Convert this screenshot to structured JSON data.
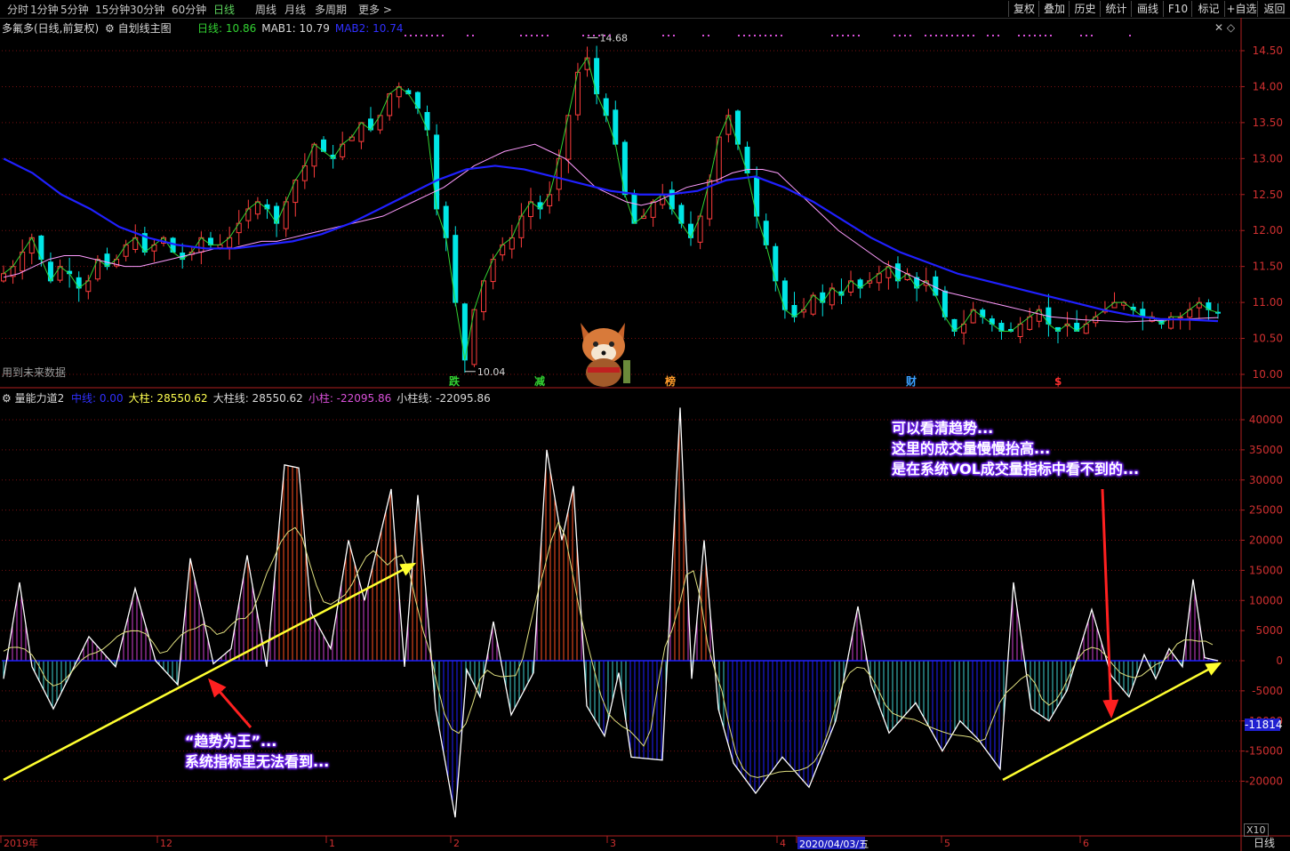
{
  "toolbar": {
    "timeframes": [
      "分时",
      "1分钟",
      "5分钟",
      "15分钟",
      "30分钟",
      "60分钟",
      "日线",
      "周线",
      "月线",
      "多周期",
      "更多 >"
    ],
    "active_index": 6,
    "right_buttons": [
      "复权",
      "叠加",
      "历史",
      "统计",
      "画线",
      "F10",
      "标记",
      "+自选",
      "返回"
    ]
  },
  "main_panel": {
    "title": "多氟多(日线,前复权)",
    "subtitle": "自划线主图",
    "indicators": [
      {
        "label": "日线: 10.86",
        "color": "#32d232"
      },
      {
        "label": "MAB1: 10.79",
        "color": "#d8d8d8"
      },
      {
        "label": "MAB2: 10.74",
        "color": "#3030ff"
      }
    ],
    "note": "用到未来数据",
    "high_label": "14.68",
    "low_label": "10.04",
    "markers": [
      {
        "text": "跌",
        "color": "#32d232"
      },
      {
        "text": "减",
        "color": "#32d232"
      },
      {
        "text": "榜",
        "color": "#ff9c2a"
      },
      {
        "text": "财",
        "color": "#3aa0ff"
      },
      {
        "text": "$",
        "color": "#ff3030"
      }
    ]
  },
  "sub_panel": {
    "title": "量能力道2",
    "indicators": [
      {
        "label": "中线: 0.00",
        "color": "#3030ff"
      },
      {
        "label": "大柱: 28550.62",
        "color": "#ffff50"
      },
      {
        "label": "大柱线: 28550.62",
        "color": "#d8d8d8"
      },
      {
        "label": "小柱: -22095.86",
        "color": "#d850d8"
      },
      {
        "label": "小柱线: -22095.86",
        "color": "#d8d8d8"
      }
    ],
    "current_value": "-11814",
    "scale_note": "X10"
  },
  "annotations": {
    "left": [
      "“趋势为王”...",
      "系统指标里无法看到..."
    ],
    "right": [
      "可以看清趋势...",
      "这里的成交量慢慢抬高...",
      "是在系统VOL成交量指标中看不到的..."
    ]
  },
  "x_axis": {
    "labels": [
      "2019年",
      "12",
      "1",
      "2",
      "3",
      "4",
      "2020/04/03/五",
      "5",
      "6"
    ],
    "period_label": "日线"
  },
  "colors": {
    "up": "#ff3c3c",
    "down": "#00e6e6",
    "ma_long": "#2020ff",
    "ma_mid": "#ff9cff",
    "ma_short": "#32d232"
  },
  "chart_data": [
    {
      "type": "candlestick",
      "title": "多氟多(日线,前复权)",
      "yaxis_ticks": [
        14.5,
        14.0,
        13.5,
        13.0,
        12.5,
        12.0,
        11.5,
        11.0,
        10.5,
        10.0
      ],
      "ylim": [
        9.9,
        14.85
      ],
      "annotated_high": 14.68,
      "annotated_low": 10.04,
      "close_series": [
        11.4,
        11.5,
        11.7,
        11.9,
        11.6,
        11.3,
        11.5,
        11.4,
        11.2,
        11.3,
        11.6,
        11.5,
        11.6,
        11.8,
        11.9,
        11.7,
        11.8,
        11.9,
        11.7,
        11.6,
        11.7,
        11.9,
        11.8,
        11.8,
        11.9,
        12.1,
        12.3,
        12.4,
        12.3,
        12.1,
        12.4,
        12.7,
        12.9,
        13.2,
        13.1,
        13.0,
        13.2,
        13.3,
        13.5,
        13.4,
        13.6,
        13.9,
        14.0,
        13.9,
        13.7,
        13.4,
        12.3,
        11.9,
        11.0,
        10.2,
        10.9,
        11.3,
        11.6,
        11.8,
        11.9,
        12.2,
        12.4,
        12.3,
        12.5,
        13.0,
        13.6,
        14.2,
        14.4,
        13.9,
        13.6,
        13.2,
        12.5,
        12.1,
        12.2,
        12.4,
        12.5,
        12.3,
        12.1,
        11.9,
        12.2,
        12.7,
        13.3,
        13.6,
        13.2,
        12.8,
        12.2,
        11.8,
        11.3,
        10.9,
        10.8,
        10.9,
        11.1,
        11.0,
        11.2,
        11.1,
        11.3,
        11.2,
        11.3,
        11.4,
        11.5,
        11.3,
        11.4,
        11.2,
        11.3,
        11.1,
        10.8,
        10.6,
        10.7,
        10.9,
        10.8,
        10.7,
        10.6,
        10.6,
        10.7,
        10.8,
        10.9,
        10.7,
        10.6,
        10.7,
        10.6,
        10.7,
        10.8,
        10.9,
        11.0,
        11.0,
        10.9,
        10.8,
        10.8,
        10.7,
        10.8,
        10.8,
        10.9,
        11.0,
        10.9,
        10.86
      ],
      "ma_mid": [
        11.35,
        11.4,
        11.5,
        11.6,
        11.65,
        11.65,
        11.6,
        11.55,
        11.5,
        11.5,
        11.55,
        11.6,
        11.65,
        11.7,
        11.75,
        11.75,
        11.8,
        11.85,
        11.85,
        11.9,
        11.95,
        12.0,
        12.05,
        12.1,
        12.15,
        12.2,
        12.3,
        12.4,
        12.5,
        12.6,
        12.75,
        12.9,
        13.0,
        13.1,
        13.15,
        13.2,
        13.1,
        13.0,
        12.8,
        12.6,
        12.5,
        12.4,
        12.35,
        12.4,
        12.5,
        12.6,
        12.65,
        12.7,
        12.8,
        12.85,
        12.85,
        12.8,
        12.6,
        12.4,
        12.2,
        12.0,
        11.85,
        11.7,
        11.55,
        11.45,
        11.35,
        11.25,
        11.15,
        11.1,
        11.05,
        11.0,
        10.95,
        10.9,
        10.85,
        10.8,
        10.78,
        10.76,
        10.75,
        10.74,
        10.73,
        10.74,
        10.75,
        10.76,
        10.77,
        10.78,
        10.79
      ],
      "ma_long": [
        13.0,
        12.8,
        12.5,
        12.3,
        12.05,
        11.9,
        11.8,
        11.75,
        11.75,
        11.8,
        11.85,
        11.95,
        12.1,
        12.3,
        12.5,
        12.7,
        12.85,
        12.9,
        12.85,
        12.75,
        12.65,
        12.55,
        12.5,
        12.5,
        12.55,
        12.7,
        12.75,
        12.6,
        12.4,
        12.15,
        11.9,
        11.7,
        11.55,
        11.4,
        11.3,
        11.2,
        11.1,
        11.0,
        10.9,
        10.82,
        10.77,
        10.76,
        10.74
      ]
    },
    {
      "type": "bar",
      "title": "量能力道2",
      "yaxis_ticks": [
        40000,
        35000,
        30000,
        25000,
        20000,
        15000,
        10000,
        5000,
        0,
        -5000,
        -10000,
        -15000,
        -20000
      ],
      "ylim": [
        -28500,
        42500
      ],
      "current_value": -11814
    }
  ]
}
